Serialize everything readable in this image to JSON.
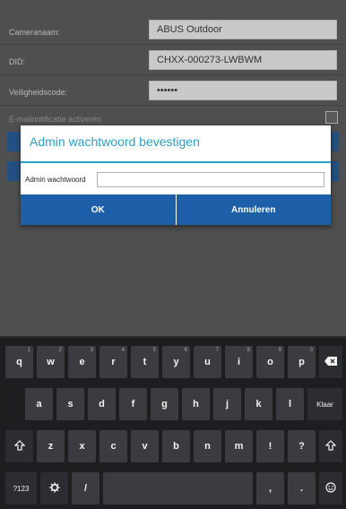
{
  "form": {
    "camera_name_label": "Cameranaam:",
    "camera_name_value": "ABUS Outdoor",
    "did_label": "DID:",
    "did_value": "CHXX-000273-LWBWM",
    "security_code_label": "Veiligheidscode:",
    "security_code_value": "••••••",
    "email_notification_label": "E-mailnotificatie activeren"
  },
  "dialog": {
    "title": "Admin wachtwoord bevestigen",
    "field_label": "Admin wachtwoord",
    "field_value": "",
    "ok_label": "OK",
    "cancel_label": "Annuleren"
  },
  "keyboard": {
    "row1": [
      {
        "k": "q",
        "hint": "1"
      },
      {
        "k": "w",
        "hint": "2"
      },
      {
        "k": "e",
        "hint": "3"
      },
      {
        "k": "r",
        "hint": "4"
      },
      {
        "k": "t",
        "hint": "5"
      },
      {
        "k": "y",
        "hint": "6"
      },
      {
        "k": "u",
        "hint": "7"
      },
      {
        "k": "i",
        "hint": "8"
      },
      {
        "k": "o",
        "hint": "9"
      },
      {
        "k": "p",
        "hint": "0"
      }
    ],
    "row2": [
      "a",
      "s",
      "d",
      "f",
      "g",
      "h",
      "j",
      "k",
      "l"
    ],
    "row3": [
      "z",
      "x",
      "c",
      "v",
      "b",
      "n",
      "m",
      "!",
      "?"
    ],
    "enter_label": "Klaar",
    "symbols_label": "?123",
    "slash_label": "/",
    "comma_label": ",",
    "period_label": ".",
    "icons": {
      "backspace": "backspace-icon",
      "shift": "shift-icon",
      "settings": "gear-icon",
      "emoji": "smiley-icon"
    }
  }
}
